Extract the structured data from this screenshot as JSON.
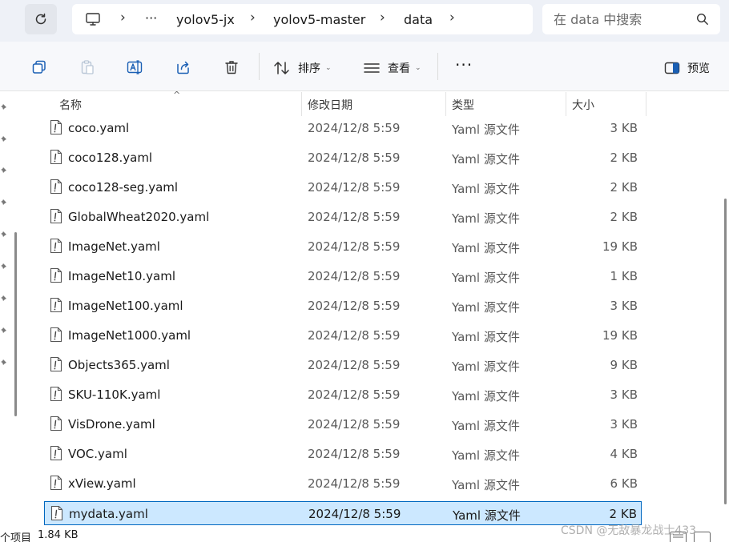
{
  "address_bar": {
    "breadcrumbs": [
      "yolov5-jx",
      "yolov5-master",
      "data"
    ],
    "overflow_label": "···",
    "separator": "›",
    "pc_icon": "monitor-icon",
    "refresh_icon": "refresh-icon"
  },
  "search": {
    "placeholder": "在 data 中搜索",
    "icon": "search-icon"
  },
  "toolbar": {
    "sort_label": "排序",
    "view_label": "查看",
    "preview_label": "预览",
    "more_label": "···",
    "caret": "⌄",
    "icons": [
      "copy-icon",
      "paste-icon",
      "rename-icon",
      "share-icon",
      "delete-icon"
    ]
  },
  "columns": {
    "name": "名称",
    "date": "修改日期",
    "type": "类型",
    "size": "大小",
    "sort_indicator": "^"
  },
  "files": [
    {
      "name": "coco.yaml",
      "date": "2024/12/8 5:59",
      "type": "Yaml 源文件",
      "size": "3 KB"
    },
    {
      "name": "coco128.yaml",
      "date": "2024/12/8 5:59",
      "type": "Yaml 源文件",
      "size": "2 KB"
    },
    {
      "name": "coco128-seg.yaml",
      "date": "2024/12/8 5:59",
      "type": "Yaml 源文件",
      "size": "2 KB"
    },
    {
      "name": "GlobalWheat2020.yaml",
      "date": "2024/12/8 5:59",
      "type": "Yaml 源文件",
      "size": "2 KB"
    },
    {
      "name": "ImageNet.yaml",
      "date": "2024/12/8 5:59",
      "type": "Yaml 源文件",
      "size": "19 KB"
    },
    {
      "name": "ImageNet10.yaml",
      "date": "2024/12/8 5:59",
      "type": "Yaml 源文件",
      "size": "1 KB"
    },
    {
      "name": "ImageNet100.yaml",
      "date": "2024/12/8 5:59",
      "type": "Yaml 源文件",
      "size": "3 KB"
    },
    {
      "name": "ImageNet1000.yaml",
      "date": "2024/12/8 5:59",
      "type": "Yaml 源文件",
      "size": "19 KB"
    },
    {
      "name": "Objects365.yaml",
      "date": "2024/12/8 5:59",
      "type": "Yaml 源文件",
      "size": "9 KB"
    },
    {
      "name": "SKU-110K.yaml",
      "date": "2024/12/8 5:59",
      "type": "Yaml 源文件",
      "size": "3 KB"
    },
    {
      "name": "VisDrone.yaml",
      "date": "2024/12/8 5:59",
      "type": "Yaml 源文件",
      "size": "3 KB"
    },
    {
      "name": "VOC.yaml",
      "date": "2024/12/8 5:59",
      "type": "Yaml 源文件",
      "size": "4 KB"
    },
    {
      "name": "xView.yaml",
      "date": "2024/12/8 5:59",
      "type": "Yaml 源文件",
      "size": "6 KB"
    },
    {
      "name": "mydata.yaml",
      "date": "2024/12/8 5:59",
      "type": "Yaml 源文件",
      "size": "2 KB",
      "selected": true
    }
  ],
  "status_bar": {
    "item_count": "个项目",
    "selected_size": "1.84 KB"
  },
  "watermark": "CSDN @无敌暴龙战士433",
  "colors": {
    "selection_bg": "#cce8ff",
    "selection_border": "#0067c0",
    "address_bg": "#eef1f7",
    "toolbar_bg": "#f7f8fb"
  }
}
